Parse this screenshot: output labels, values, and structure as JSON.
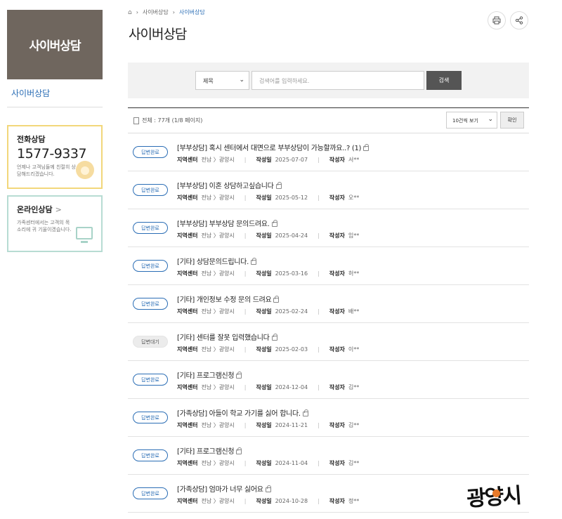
{
  "sidebar": {
    "banner_title": "사이버상담",
    "active_link": "사이버상담",
    "phone_box": {
      "title": "전화상담",
      "number": "1577-9337",
      "desc": "언제나 고객님들께 친절히 상담해드리겠습니다."
    },
    "online_box": {
      "title": "온라인상담",
      "arrow": ">",
      "desc": "가족센터에서는 고객의 목소리에 귀 기울이겠습니다."
    }
  },
  "breadcrumb": {
    "items": [
      "사이버상담",
      "사이버상담"
    ]
  },
  "page_title": "사이버상담",
  "search": {
    "field_selected": "제목",
    "placeholder": "검색어를 입력하세요.",
    "button_label": "검색"
  },
  "list": {
    "total_text": "전체 : 77개 (1/8 페이지)",
    "per_page_selected": "10건씩 보기",
    "confirm_label": "확인",
    "meta_labels": {
      "center": "지역센터",
      "date": "작성일",
      "author": "작성자"
    },
    "rows": [
      {
        "status": "답변완료",
        "status_type": "done",
        "title": "[부부상담] 혹시 센터에서 대면으로 부부상담이 가능할까요..? (1)",
        "center": "전남 〉광양시",
        "date": "2025-07-07",
        "author": "서**"
      },
      {
        "status": "답변완료",
        "status_type": "done",
        "title": "[부부상담] 이혼 상담하고싶습니다",
        "center": "전남 〉광양시",
        "date": "2025-05-12",
        "author": "오**"
      },
      {
        "status": "답변완료",
        "status_type": "done",
        "title": "[부부상담] 부부상담 문의드려요.",
        "center": "전남 〉광양시",
        "date": "2025-04-24",
        "author": "임**"
      },
      {
        "status": "답변완료",
        "status_type": "done",
        "title": "[기타] 상담문의드립니다.",
        "center": "전남 〉광양시",
        "date": "2025-03-16",
        "author": "허**"
      },
      {
        "status": "답변완료",
        "status_type": "done",
        "title": "[기타] 개인정보 수정 문의 드려요",
        "center": "전남 〉광양시",
        "date": "2025-02-24",
        "author": "배**"
      },
      {
        "status": "답변대기",
        "status_type": "wait",
        "title": "[기타] 센터를 잘못 입력했습니다",
        "center": "전남 〉광양시",
        "date": "2025-02-03",
        "author": "이**"
      },
      {
        "status": "답변완료",
        "status_type": "done",
        "title": "[기타] 프로그램신청",
        "center": "전남 〉광양시",
        "date": "2024-12-04",
        "author": "김**"
      },
      {
        "status": "답변완료",
        "status_type": "done",
        "title": "[가족상담] 아들이 학교 가기를 싫어 합니다.",
        "center": "전남 〉광양시",
        "date": "2024-11-21",
        "author": "김**"
      },
      {
        "status": "답변완료",
        "status_type": "done",
        "title": "[기타] 프로그램신청",
        "center": "전남 〉광양시",
        "date": "2024-11-04",
        "author": "김**"
      },
      {
        "status": "답변완료",
        "status_type": "done",
        "title": "[가족상담] 엄마가 너무 싫어요",
        "center": "전남 〉광양시",
        "date": "2024-10-28",
        "author": "정**"
      }
    ]
  },
  "watermark": "광양시",
  "colors": {
    "accent_blue": "#2a6db5",
    "banner_bg": "#6f665e",
    "phone_border": "#f2d77a",
    "online_border": "#b7dcd3"
  }
}
